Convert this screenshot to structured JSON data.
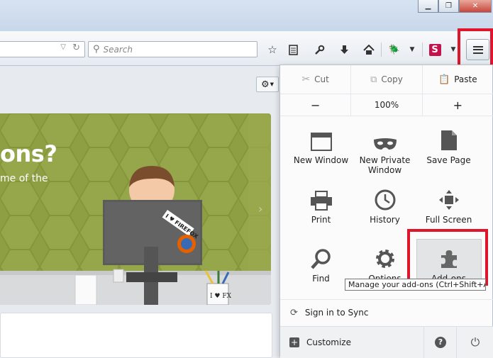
{
  "toolbar": {
    "search_placeholder": "Search",
    "icons": [
      "bookmark-star-icon",
      "bookmarks-list-icon",
      "wrench-icon",
      "download-icon",
      "home-icon",
      "bug-icon",
      "s-extension-icon",
      "menu-icon"
    ]
  },
  "hero": {
    "title_fragment": "ons?",
    "subtitle_fragment": "me of the",
    "sticker_text": "I ♥ FIREFOX",
    "mug_text": "I ♥ FX"
  },
  "menu": {
    "edit": {
      "cut": "Cut",
      "copy": "Copy",
      "paste": "Paste"
    },
    "zoom": {
      "minus": "−",
      "level": "100%",
      "plus": "+"
    },
    "items": [
      {
        "id": "new-window",
        "label": "New Window"
      },
      {
        "id": "new-private-window",
        "label": "New Private Window"
      },
      {
        "id": "save-page",
        "label": "Save Page"
      },
      {
        "id": "print",
        "label": "Print"
      },
      {
        "id": "history",
        "label": "History"
      },
      {
        "id": "full-screen",
        "label": "Full Screen"
      },
      {
        "id": "find",
        "label": "Find"
      },
      {
        "id": "options",
        "label": "Options"
      },
      {
        "id": "add-ons",
        "label": "Add-ons"
      }
    ],
    "tooltip": "Manage your add-ons (Ctrl+Shift+A)",
    "sync": "Sign in to Sync",
    "customize": "Customize"
  },
  "colors": {
    "highlight_red": "#e0142b",
    "hero_green": "#8a9a3e"
  }
}
